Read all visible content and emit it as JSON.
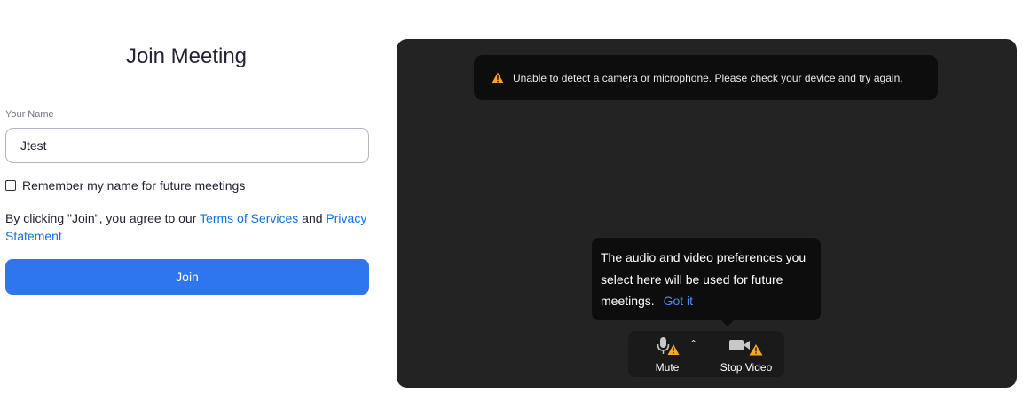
{
  "join_form": {
    "title": "Join Meeting",
    "name_label": "Your Name",
    "name_value": "Jtest",
    "remember_label": "Remember my name for future meetings",
    "remember_checked": false,
    "agree_prefix": "By clicking \"Join\", you agree to our ",
    "terms_link": "Terms of Services",
    "agree_and": " and ",
    "privacy_link": "Privacy Statement",
    "join_button": "Join"
  },
  "preview": {
    "alert_text": "Unable to detect a camera or microphone. Please check your device and try again.",
    "tooltip_text": "The audio and video preferences you select here will be used for future meetings.",
    "tooltip_action": "Got it",
    "mute_label": "Mute",
    "stop_video_label": "Stop Video"
  },
  "colors": {
    "accent": "#2d76ee",
    "link": "#0e72ed",
    "warning": "#f5a623",
    "preview_bg": "#232323"
  },
  "icons": [
    "warning-icon",
    "microphone-icon",
    "caret-up-icon",
    "video-camera-icon"
  ]
}
